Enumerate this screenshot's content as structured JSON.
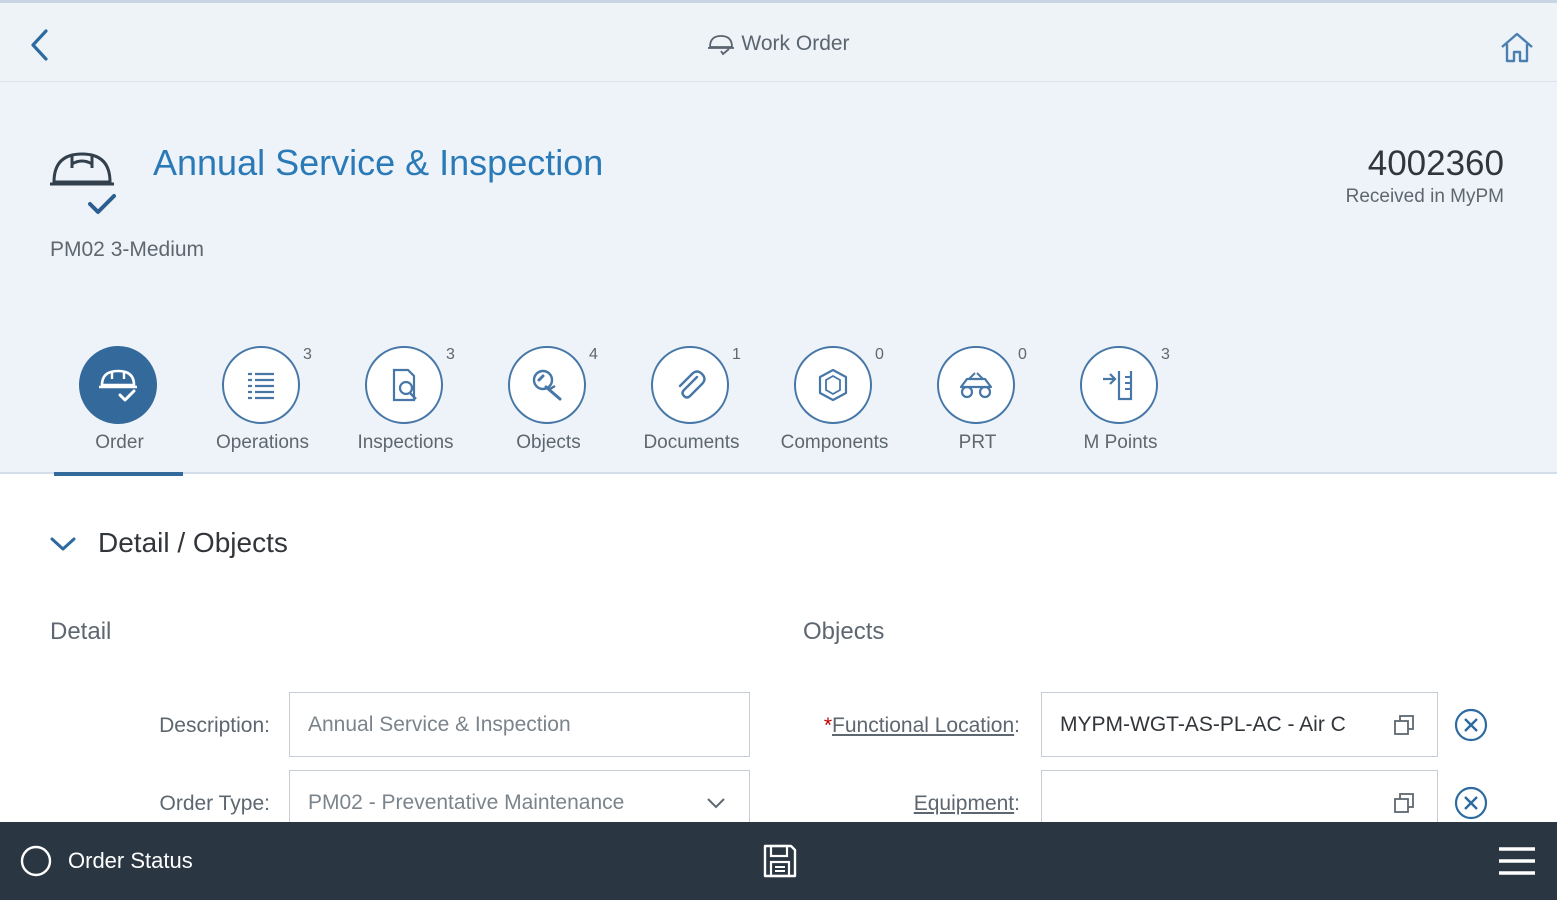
{
  "nav": {
    "title": "Work Order",
    "back_icon": "chevron-left-icon",
    "home_icon": "home-icon"
  },
  "header": {
    "title": "Annual Service & Inspection",
    "subtitle": "PM02 3-Medium",
    "order_number": "4002360",
    "status": "Received in MyPM"
  },
  "tabs": [
    {
      "label": "Order",
      "count": "",
      "icon": "hard-hat-check-icon",
      "active": true
    },
    {
      "label": "Operations",
      "count": "3",
      "icon": "list-icon"
    },
    {
      "label": "Inspections",
      "count": "3",
      "icon": "inspection-icon"
    },
    {
      "label": "Objects",
      "count": "4",
      "icon": "wrench-search-icon"
    },
    {
      "label": "Documents",
      "count": "1",
      "icon": "paperclip-icon"
    },
    {
      "label": "Components",
      "count": "0",
      "icon": "cube-icon"
    },
    {
      "label": "PRT",
      "count": "0",
      "icon": "vehicle-icon"
    },
    {
      "label": "M Points",
      "count": "3",
      "icon": "measuring-point-icon"
    }
  ],
  "section": {
    "title": "Detail / Objects"
  },
  "detail": {
    "title": "Detail",
    "description_label": "Description:",
    "description_placeholder": "Annual Service & Inspection",
    "order_type_label": "Order Type:",
    "order_type_value": "PM02 - Preventative Maintenance"
  },
  "objects": {
    "title": "Objects",
    "required_mark": "*",
    "functional_location_label": "Functional Location",
    "functional_location_value": "MYPM-WGT-AS-PL-AC - Air C",
    "equipment_label": "Equipment",
    "equipment_value": "",
    "colon": ":"
  },
  "footer": {
    "status_label": "Order Status"
  },
  "colors": {
    "accent": "#346a9b",
    "title_blue": "#2a7ab8",
    "footer_bg": "#2a3642",
    "header_bg": "#edf3f9"
  }
}
